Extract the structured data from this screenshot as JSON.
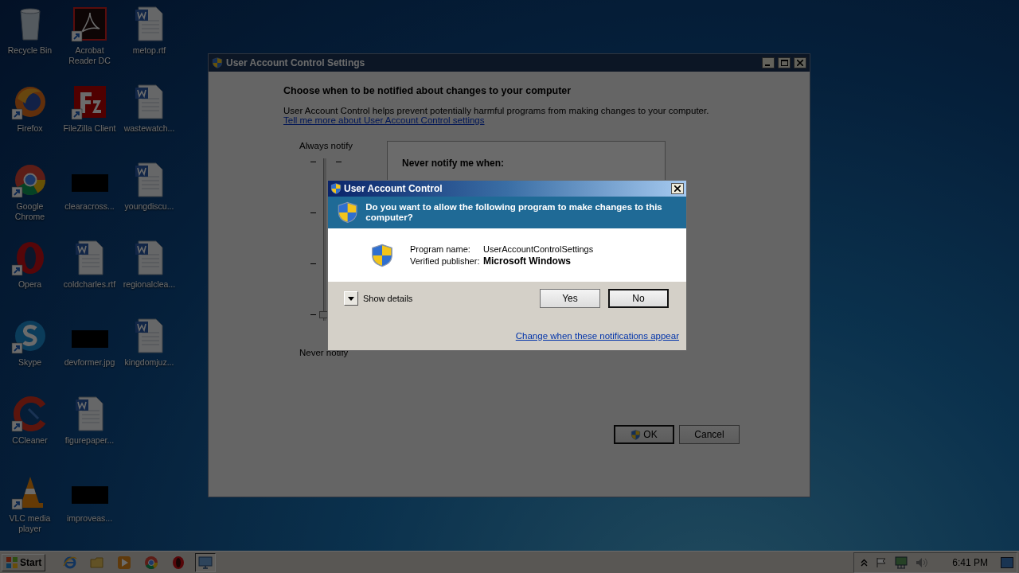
{
  "desktop": {
    "icons": [
      {
        "label": "Recycle Bin",
        "kind": "recycle",
        "shortcut": false
      },
      {
        "label": "Firefox",
        "kind": "firefox",
        "shortcut": true
      },
      {
        "label": "Google Chrome",
        "kind": "chrome",
        "shortcut": true
      },
      {
        "label": "Opera",
        "kind": "opera",
        "shortcut": true
      },
      {
        "label": "Skype",
        "kind": "skype",
        "shortcut": true
      },
      {
        "label": "CCleaner",
        "kind": "ccleaner",
        "shortcut": true
      },
      {
        "label": "VLC media player",
        "kind": "vlc",
        "shortcut": true
      },
      {
        "label": "Acrobat Reader DC",
        "kind": "pdf",
        "shortcut": true
      },
      {
        "label": "FileZilla Client",
        "kind": "filezilla",
        "shortcut": true
      },
      {
        "label": "clearacross...",
        "kind": "image",
        "shortcut": false
      },
      {
        "label": "coldcharles.rtf",
        "kind": "word",
        "shortcut": false
      },
      {
        "label": "devformer.jpg",
        "kind": "image",
        "shortcut": false
      },
      {
        "label": "figurepaper...",
        "kind": "word",
        "shortcut": false
      },
      {
        "label": "improveas...",
        "kind": "image",
        "shortcut": false
      },
      {
        "label": "metop.rtf",
        "kind": "word",
        "shortcut": false
      },
      {
        "label": "wastewatch...",
        "kind": "word",
        "shortcut": false
      },
      {
        "label": "youngdiscu...",
        "kind": "word",
        "shortcut": false
      },
      {
        "label": "regionalclea...",
        "kind": "word",
        "shortcut": false
      },
      {
        "label": "kingdomjuz...",
        "kind": "word",
        "shortcut": false
      }
    ]
  },
  "settings_window": {
    "title": "User Account Control Settings",
    "heading": "Choose when to be notified about changes to your computer",
    "description": "User Account Control helps prevent potentially harmful programs from making changes to your computer.",
    "link": "Tell me more about User Account Control settings",
    "slider": {
      "top_label": "Always notify",
      "bottom_label": "Never notify",
      "level": 0
    },
    "panel_heading": "Never notify me when:",
    "buttons": [
      {
        "label": "OK",
        "default": true,
        "shield": true
      },
      {
        "label": "Cancel",
        "default": false,
        "shield": false
      }
    ]
  },
  "uac_dialog": {
    "title": "User Account Control",
    "question": "Do you want to allow the following program to make changes to this computer?",
    "program_name_label": "Program name:",
    "program_name": "UserAccountControlSettings",
    "publisher_label": "Verified publisher:",
    "publisher": "Microsoft Windows",
    "details_toggle": "Show details",
    "buttons": [
      {
        "label": "Yes",
        "default": false
      },
      {
        "label": "No",
        "default": true
      }
    ],
    "link": "Change when these notifications appear"
  },
  "taskbar": {
    "start": "Start",
    "apps": [
      {
        "kind": "ie",
        "active": false
      },
      {
        "kind": "folder",
        "active": false
      },
      {
        "kind": "media",
        "active": false
      },
      {
        "kind": "chrome",
        "active": false
      },
      {
        "kind": "opera",
        "active": false
      },
      {
        "kind": "settings",
        "active": true
      }
    ],
    "clock": "6:41 PM"
  }
}
